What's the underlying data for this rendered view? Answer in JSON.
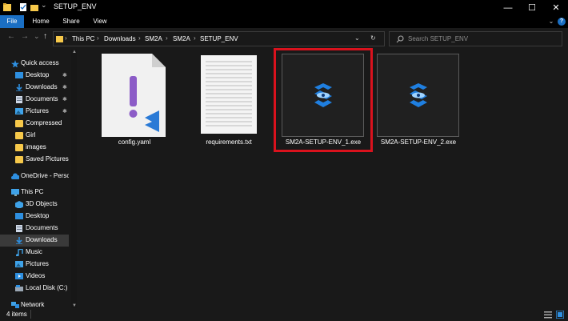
{
  "titlebar": {
    "title": "SETUP_ENV",
    "minimize_glyph": "—",
    "maximize_glyph": "☐",
    "close_glyph": "✕"
  },
  "ribbon": {
    "tabs": [
      "File",
      "Home",
      "Share",
      "View"
    ],
    "expand_glyph": "⌄",
    "help_glyph": "?"
  },
  "nav": {
    "back_glyph": "←",
    "forward_glyph": "→",
    "recent_glyph": "⌄",
    "up_glyph": "↑",
    "breadcrumb": [
      "This PC",
      "Downloads",
      "SM2A",
      "SM2A",
      "SETUP_ENV"
    ],
    "breadcrumb_sep": "›",
    "dropdown_glyph": "⌄",
    "refresh_glyph": "↻",
    "search_placeholder": "Search SETUP_ENV"
  },
  "sidebar": {
    "quick_access": "Quick access",
    "pinned": [
      "Desktop",
      "Downloads",
      "Documents",
      "Pictures"
    ],
    "folders": [
      "Compressed",
      "Girl",
      "images",
      "Saved Pictures"
    ],
    "onedrive": "OneDrive - Persor",
    "this_pc": "This PC",
    "this_pc_items": [
      "3D Objects",
      "Desktop",
      "Documents",
      "Downloads",
      "Music",
      "Pictures",
      "Videos",
      "Local Disk (C:)"
    ],
    "network": "Network",
    "pin_glyph": "✱"
  },
  "files": [
    {
      "name": "config.yaml",
      "icon": "yaml-vscode-icon",
      "selected": false
    },
    {
      "name": "requirements.txt",
      "icon": "text-file-icon",
      "selected": false
    },
    {
      "name": "SM2A-SETUP-ENV_1.exe",
      "icon": "sm2a-app-icon",
      "selected": true
    },
    {
      "name": "SM2A-SETUP-ENV_2.exe",
      "icon": "sm2a-app-icon",
      "selected": true
    }
  ],
  "status": {
    "count": "4 items"
  },
  "colors": {
    "accent": "#1a6fc4",
    "highlight_box": "#d9121d",
    "folder": "#f6c84a"
  }
}
